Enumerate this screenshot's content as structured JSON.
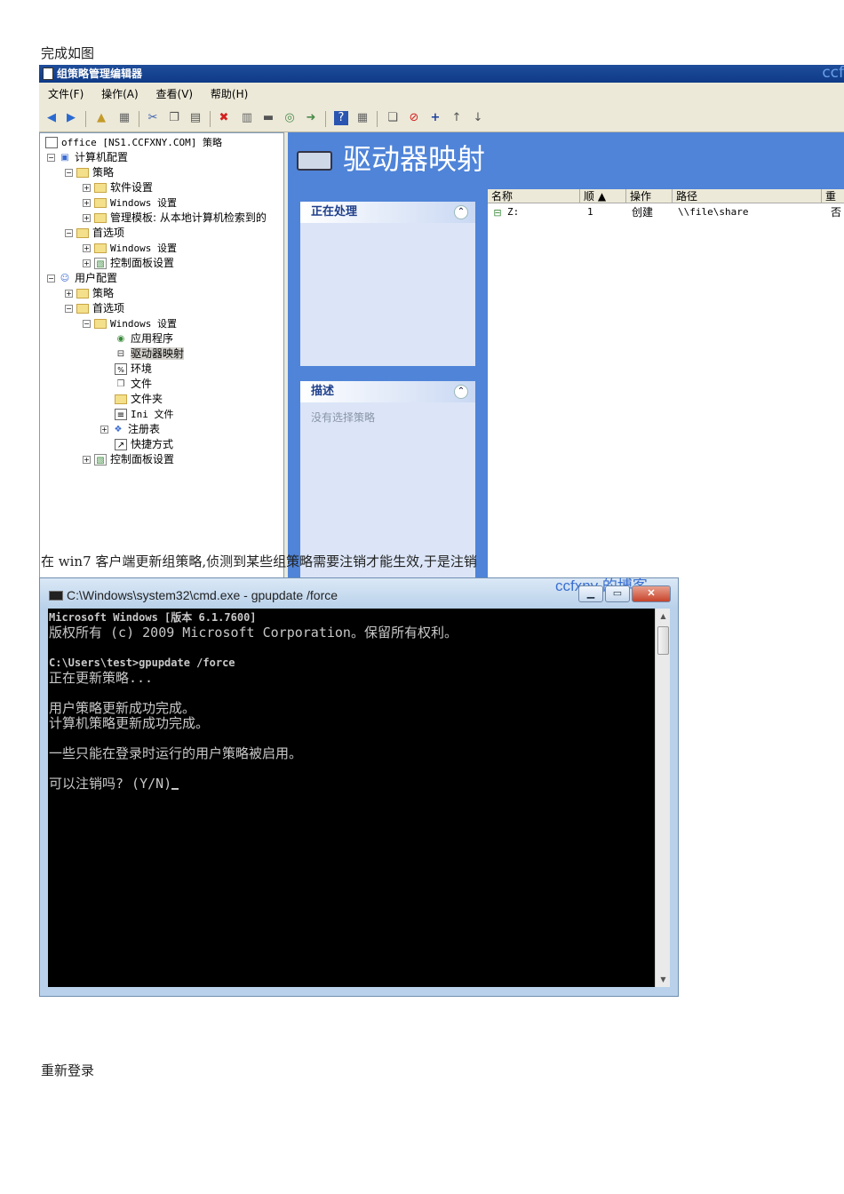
{
  "doc": {
    "caption_top": "完成如图",
    "caption_mid": "在 win7 客户端更新组策略,侦测到某些组策略需要注销才能生效,于是注销",
    "caption_bottom": "重新登录"
  },
  "gpme": {
    "title": "组策略管理编辑器",
    "watermark": "ccf",
    "menu": [
      "文件(F)",
      "操作(A)",
      "查看(V)",
      "帮助(H)"
    ],
    "tree": [
      {
        "label": "office [NS1.CCFXNY.COM] 策略"
      },
      {
        "label": "计算机配置"
      },
      {
        "label": "策略"
      },
      {
        "label": "软件设置"
      },
      {
        "label": "Windows 设置"
      },
      {
        "label": "管理模板: 从本地计算机检索到的"
      },
      {
        "label": "首选项"
      },
      {
        "label": "Windows 设置"
      },
      {
        "label": "控制面板设置"
      },
      {
        "label": "用户配置"
      },
      {
        "label": "策略"
      },
      {
        "label": "首选项"
      },
      {
        "label": "Windows 设置"
      },
      {
        "label": "应用程序"
      },
      {
        "label": "驱动器映射"
      },
      {
        "label": "环境"
      },
      {
        "label": "文件"
      },
      {
        "label": "文件夹"
      },
      {
        "label": "Ini 文件"
      },
      {
        "label": "注册表"
      },
      {
        "label": "快捷方式"
      },
      {
        "label": "控制面板设置"
      }
    ],
    "heading": "驱动器映射",
    "panel_processing": "正在处理",
    "panel_description": "描述",
    "panel_description_body": "没有选择策略",
    "columns": [
      "名称",
      "顺 ▲",
      "操作",
      "路径",
      "重"
    ],
    "rows": [
      {
        "name": "Z:",
        "order": "1",
        "action": "创建",
        "path": "\\\\file\\share",
        "extra": "否"
      }
    ]
  },
  "cmd": {
    "title": "C:\\Windows\\system32\\cmd.exe - gpupdate  /force",
    "watermark": "ccfxny 的博客",
    "lines": [
      "Microsoft Windows [版本 6.1.7600]",
      "版权所有 (c) 2009 Microsoft Corporation。保留所有权利。",
      "",
      "C:\\Users\\test>gpupdate /force",
      "正在更新策略...",
      "",
      "用户策略更新成功完成。",
      "计算机策略更新成功完成。",
      "",
      "一些只能在登录时运行的用户策略被启用。",
      "",
      "可以注销吗? (Y/N)"
    ]
  }
}
